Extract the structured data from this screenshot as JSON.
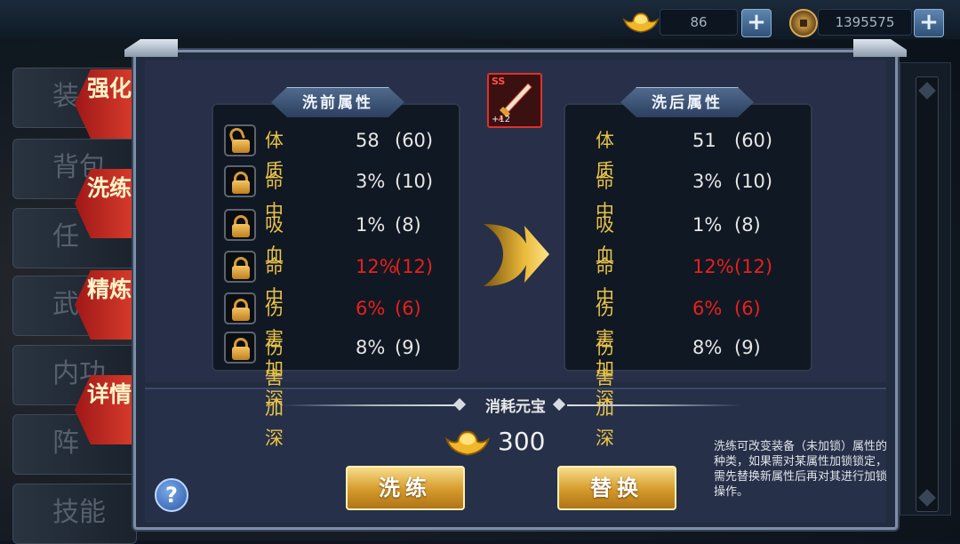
{
  "currency": {
    "ingot_amount": "86",
    "coin_amount": "1395575"
  },
  "side_tabs": [
    "装",
    "背包",
    "任",
    "武",
    "内功",
    "阵",
    "技能"
  ],
  "red_tabs": [
    {
      "label": "强化"
    },
    {
      "label": "洗练"
    },
    {
      "label": "精炼"
    },
    {
      "label": "详情"
    }
  ],
  "equipment": {
    "grade": "SS",
    "level": "+12"
  },
  "before": {
    "title": "洗前属性",
    "rows": [
      {
        "name": "体质",
        "value": "58",
        "cap": "(60)",
        "red": false,
        "locked": false
      },
      {
        "name": "命中",
        "value": "3%",
        "cap": "(10)",
        "red": false,
        "locked": true
      },
      {
        "name": "吸血",
        "value": "1%",
        "cap": "(8)",
        "red": false,
        "locked": true
      },
      {
        "name": "命中",
        "value": "12%",
        "cap": "(12)",
        "red": true,
        "locked": true
      },
      {
        "name": "伤害加深",
        "value": "6%",
        "cap": "(6)",
        "red": true,
        "locked": true
      },
      {
        "name": "伤害加深",
        "value": "8%",
        "cap": "(9)",
        "red": false,
        "locked": true
      }
    ]
  },
  "after": {
    "title": "洗后属性",
    "rows": [
      {
        "name": "体质",
        "value": "51",
        "cap": "(60)",
        "red": false
      },
      {
        "name": "命中",
        "value": "3%",
        "cap": "(10)",
        "red": false
      },
      {
        "name": "吸血",
        "value": "1%",
        "cap": "(8)",
        "red": false
      },
      {
        "name": "命中",
        "value": "12%",
        "cap": "(12)",
        "red": true
      },
      {
        "name": "伤害加深",
        "value": "6%",
        "cap": "(6)",
        "red": true
      },
      {
        "name": "伤害加深",
        "value": "8%",
        "cap": "(9)",
        "red": false
      }
    ]
  },
  "cost": {
    "title": "消耗元宝",
    "amount": "300"
  },
  "buttons": {
    "refine": "洗练",
    "replace": "替换",
    "help": "?"
  },
  "note": "洗练可改变装备（未加锁）属性的种类，如果需对某属性加锁锁定，需先替换新属性后再对其进行加锁操作。",
  "icons": [
    "gold-ingot-icon",
    "copper-coin-icon",
    "plus-icon",
    "lock-icon",
    "unlock-icon",
    "arrow-right-icon",
    "help-icon",
    "sword-icon"
  ]
}
